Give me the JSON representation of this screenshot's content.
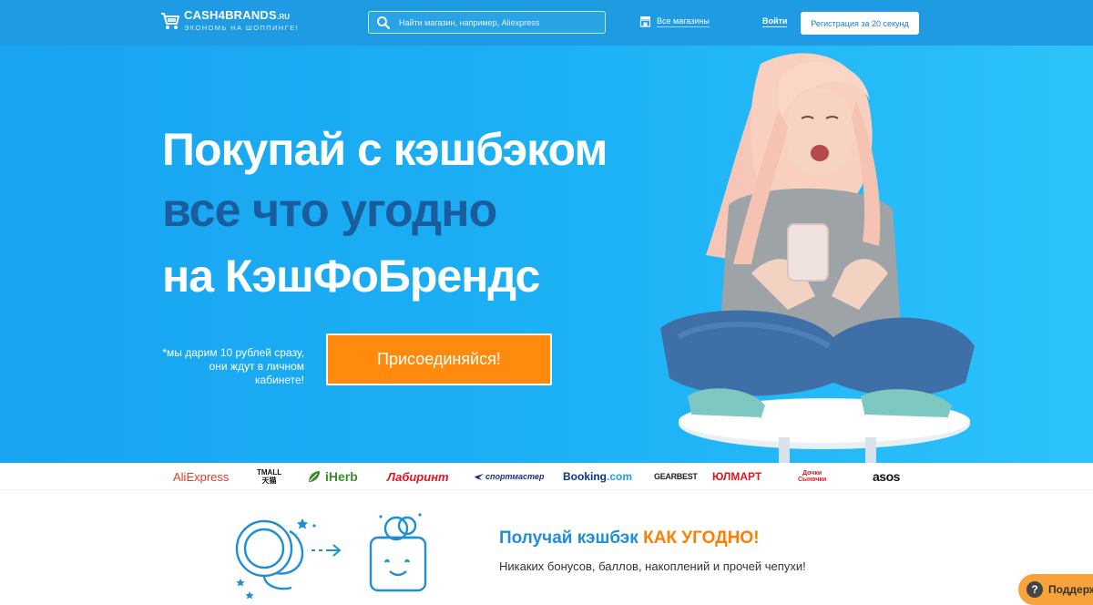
{
  "header": {
    "logo_name": "CASH4BRANDS",
    "logo_tld": ".RU",
    "logo_slogan": "ЭКОНОМЬ НА ШОППИНГЕ!",
    "search_placeholder": "Найти магазин, например, Aliexpress",
    "all_stores_label": "Все магазины",
    "login_label": "Войти",
    "register_label": "Регистрация за 20 секунд"
  },
  "hero": {
    "line1": "Покупай с кэшбэком",
    "line2": "все что угодно",
    "line3": "на КэшФоБрендс",
    "gift_note_line1": "*мы дарим 10 рублей сразу,",
    "gift_note_line2": "они ждут в личном кабинете!",
    "join_button_label": "Присоединяйся!"
  },
  "brands": {
    "aliexpress": "AliExpress",
    "tmall_top": "TMALL",
    "tmall_bottom": "天猫",
    "iherb": "iHerb",
    "labirint": "Лабиринт",
    "sportmaster": "спортмастер",
    "booking_main": "Booking",
    "booking_tld": ".com",
    "gearbest": "GEARBEST",
    "ulmart_mark": "Ю",
    "ulmart": "ЮЛМАРТ",
    "dochki_line1": "Дочки",
    "dochki_line2": "Сыночки",
    "asos": "asos"
  },
  "promo": {
    "title_main": "Получай кэшбэк ",
    "title_accent": "КАК УГОДНО!",
    "subtitle": "Никаких бонусов, баллов, накоплений и прочей чепухи!"
  },
  "support": {
    "icon_glyph": "?",
    "label": "Поддерж"
  },
  "colors": {
    "header_bg": "#1e9be2",
    "hero_bg": "#1cb0f5",
    "hero_accent_text": "#1a5d9e",
    "cta_orange": "#ff8a0e",
    "promo_blue": "#1e8fd6",
    "promo_orange": "#ff7f00",
    "support_bg": "#f7a23a"
  },
  "icons": {
    "logo": "shopping-cart-icon",
    "search": "search-icon",
    "stores": "store-icon",
    "illustration": "coins-to-wallet-icon"
  }
}
